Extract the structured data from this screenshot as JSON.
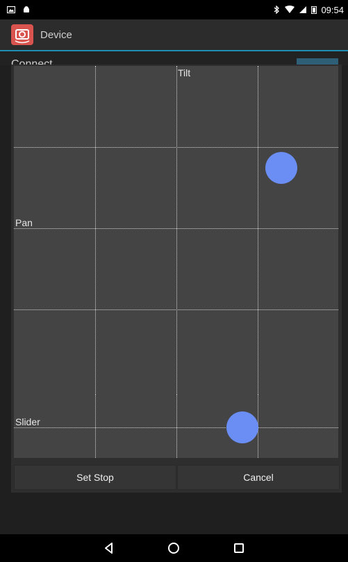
{
  "status_bar": {
    "time": "09:54",
    "icons": [
      "gallery-icon",
      "android-icon",
      "bluetooth-icon",
      "wifi-icon",
      "signal-icon",
      "battery-icon"
    ]
  },
  "app_bar": {
    "title": "Device",
    "icon": "camera-icon",
    "accent_color": "#1e8fb3"
  },
  "background_screen": {
    "partial_label": "Connect"
  },
  "dialog": {
    "main_pad": {
      "tilt_label": "Tilt",
      "pan_label": "Pan",
      "handle_color": "#6b8ef5"
    },
    "slider_pad": {
      "slider_label": "Slider"
    },
    "buttons": {
      "set_stop": "Set Stop",
      "cancel": "Cancel"
    }
  },
  "nav_bar": {
    "icons": [
      "back-icon",
      "home-icon",
      "recents-icon"
    ]
  }
}
